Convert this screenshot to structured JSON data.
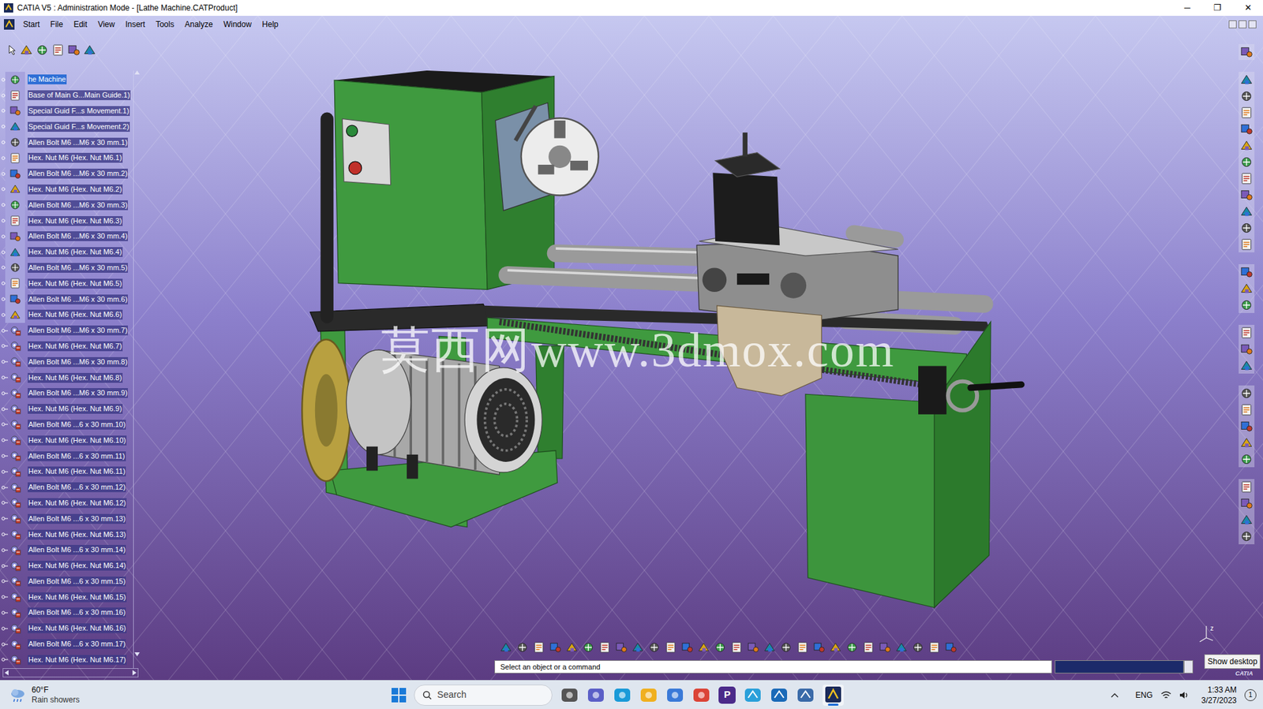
{
  "window": {
    "title": "CATIA V5 : Administration Mode - [Lathe Machine.CATProduct]",
    "controls": [
      "─",
      "❐",
      "✕"
    ]
  },
  "menu": [
    "Start",
    "File",
    "Edit",
    "View",
    "Insert",
    "Tools",
    "Analyze",
    "Window",
    "Help"
  ],
  "tree": {
    "items": [
      {
        "label": "he Machine",
        "selected": true
      },
      {
        "label": "Base of Main G...Main Guide.1)",
        "selected": false
      },
      {
        "label": "Special Guid F...s Movement.1)",
        "selected": false
      },
      {
        "label": "Special Guid F...s Movement.2)",
        "selected": false
      },
      {
        "label": "Allen Bolt M6 ...M6 x 30 mm.1)",
        "selected": false
      },
      {
        "label": "Hex. Nut M6 (Hex. Nut M6.1)",
        "selected": false
      },
      {
        "label": "Allen Bolt M6 ...M6 x 30 mm.2)",
        "selected": false
      },
      {
        "label": "Hex. Nut M6 (Hex. Nut M6.2)",
        "selected": false
      },
      {
        "label": "Allen Bolt M6 ...M6 x 30 mm.3)",
        "selected": false
      },
      {
        "label": "Hex. Nut M6 (Hex. Nut M6.3)",
        "selected": false
      },
      {
        "label": "Allen Bolt M6 ...M6 x 30 mm.4)",
        "selected": false
      },
      {
        "label": "Hex. Nut M6 (Hex. Nut M6.4)",
        "selected": false
      },
      {
        "label": "Allen Bolt M6 ...M6 x 30 mm.5)",
        "selected": false
      },
      {
        "label": "Hex. Nut M6 (Hex. Nut M6.5)",
        "selected": false
      },
      {
        "label": "Allen Bolt M6 ...M6 x 30 mm.6)",
        "selected": false
      },
      {
        "label": "Hex. Nut M6 (Hex. Nut M6.6)",
        "selected": false
      },
      {
        "label": "Allen Bolt M6 ...M6 x 30 mm.7)",
        "selected": false
      },
      {
        "label": "Hex. Nut M6 (Hex. Nut M6.7)",
        "selected": false
      },
      {
        "label": "Allen Bolt M6 ...M6 x 30 mm.8)",
        "selected": false
      },
      {
        "label": "Hex. Nut M6 (Hex. Nut M6.8)",
        "selected": false
      },
      {
        "label": "Allen Bolt M6 ...M6 x 30 mm.9)",
        "selected": false
      },
      {
        "label": "Hex. Nut M6 (Hex. Nut M6.9)",
        "selected": false
      },
      {
        "label": "Allen Bolt M6 ...6 x 30 mm.10)",
        "selected": false
      },
      {
        "label": "Hex. Nut M6 (Hex. Nut M6.10)",
        "selected": false
      },
      {
        "label": "Allen Bolt M6 ...6 x 30 mm.11)",
        "selected": false
      },
      {
        "label": "Hex. Nut M6 (Hex. Nut M6.11)",
        "selected": false
      },
      {
        "label": "Allen Bolt M6 ...6 x 30 mm.12)",
        "selected": false
      },
      {
        "label": "Hex. Nut M6 (Hex. Nut M6.12)",
        "selected": false
      },
      {
        "label": "Allen Bolt M6 ...6 x 30 mm.13)",
        "selected": false
      },
      {
        "label": "Hex. Nut M6 (Hex. Nut M6.13)",
        "selected": false
      },
      {
        "label": "Allen Bolt M6 ...6 x 30 mm.14)",
        "selected": false
      },
      {
        "label": "Hex. Nut M6 (Hex. Nut M6.14)",
        "selected": false
      },
      {
        "label": "Allen Bolt M6 ...6 x 30 mm.15)",
        "selected": false
      },
      {
        "label": "Hex. Nut M6 (Hex. Nut M6.15)",
        "selected": false
      },
      {
        "label": "Allen Bolt M6 ...6 x 30 mm.16)",
        "selected": false
      },
      {
        "label": "Hex. Nut M6 (Hex. Nut M6.16)",
        "selected": false
      },
      {
        "label": "Allen Bolt M6 ...6 x 30 mm.17)",
        "selected": false
      },
      {
        "label": "Hex. Nut M6 (Hex. Nut M6.17)",
        "selected": false
      }
    ]
  },
  "watermark": "莫西网www.3dmox.com",
  "compass": {
    "axis": "z"
  },
  "status_bar": {
    "prompt": "Select an object or a command"
  },
  "tooltip": "Show desktop",
  "logo": "CATIA",
  "taskbar": {
    "weather": {
      "temperature": "60°F",
      "condition": "Rain showers"
    },
    "search": "Search",
    "pinned_app_letter": "P",
    "language": "ENG",
    "time": "1:33 AM",
    "date": "3/27/2023",
    "notifications": "1"
  }
}
